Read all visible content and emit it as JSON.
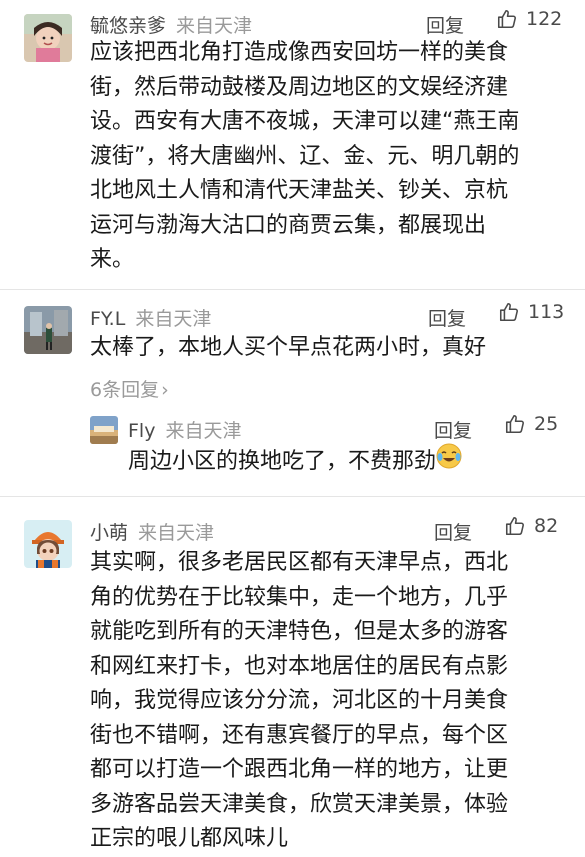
{
  "colors": {
    "text": "#1a1a1a",
    "meta": "#4a4a4a",
    "muted": "#9a9a9a",
    "divider": "#e5e5e5"
  },
  "comments": [
    {
      "user": "毓悠亲爹",
      "location": "来自天津",
      "reply_label": "回复",
      "likes": "122",
      "lines": [
        "应该把西北角打造成像西安回坊一样的美食",
        "街，然后带动鼓楼及周边地区的文娱经济建",
        "设。西安有大唐不夜城，天津可以建“燕王南",
        "渡街”，将大唐幽州、辽、金、元、明几朝的",
        "北地风土人情和清代天津盐关、钞关、京杭",
        "运河与渤海大沽口的商贾云集，都展现出",
        "来。"
      ]
    },
    {
      "user": "FY.L",
      "location": "来自天津",
      "reply_label": "回复",
      "likes": "113",
      "lines": [
        "太棒了，本地人买个早点花两小时，真好"
      ],
      "more_replies": "6条回复",
      "sub_reply": {
        "user": "Fly",
        "location": "来自天津",
        "reply_label": "回复",
        "likes": "25",
        "text": "周边小区的换地吃了，不费那劲",
        "emoji": "laughing-crying-emoji"
      }
    },
    {
      "user": "小萌",
      "location": "来自天津",
      "reply_label": "回复",
      "likes": "82",
      "lines": [
        "其实啊，很多老居民区都有天津早点，西北",
        "角的优势在于比较集中，走一个地方，几乎",
        "就能吃到所有的天津特色，但是太多的游客",
        "和网红来打卡，也对本地居住的居民有点影",
        "响，我觉得应该分分流，河北区的十月美食",
        "街也不错啊，还有惠宾餐厅的早点，每个区",
        "都可以打造一个跟西北角一样的地方，让更",
        "多游客品尝天津美食，欣赏天津美景，体验",
        "正宗的哏儿都风味儿"
      ]
    }
  ]
}
